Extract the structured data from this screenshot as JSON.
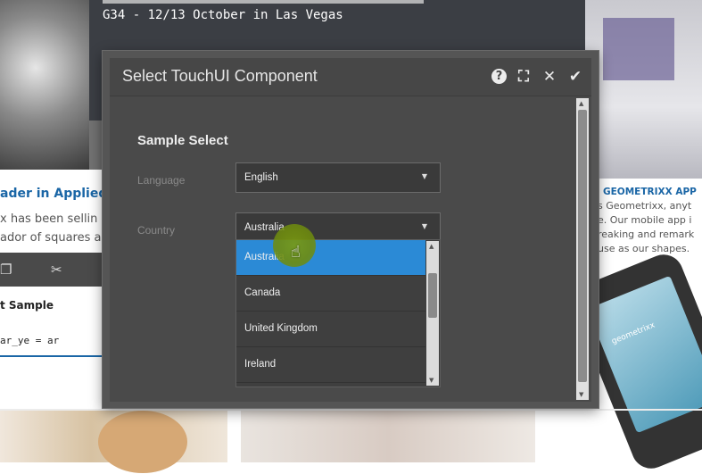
{
  "background": {
    "hero_subtitle": "G34 - 12/13 October in Las Vegas",
    "left_article": {
      "title": "ader in Applied",
      "lines": [
        "x has been sellin",
        "ador of squares a"
      ],
      "card_title": "t Sample",
      "card_code": "ar_ye = ar"
    },
    "right_article": {
      "title": "GEOMETRIXX APP",
      "lines": [
        "s Geometrixx, anyt",
        "e. Our mobile app i",
        "reaking and remark",
        "use as our shapes."
      ]
    },
    "phone_screen_text": "geometrixx"
  },
  "dialog": {
    "title": "Select TouchUI Component",
    "header_icons": [
      "help-icon",
      "fullscreen-icon",
      "close-icon",
      "check-icon"
    ],
    "section_title": "Sample Select",
    "language": {
      "label": "Language",
      "value": "English"
    },
    "country": {
      "label": "Country",
      "value": "Australia",
      "options": [
        "Australia",
        "Canada",
        "United Kingdom",
        "Ireland"
      ],
      "selected_index": 0
    },
    "accent_color": "#2b8ad6"
  }
}
